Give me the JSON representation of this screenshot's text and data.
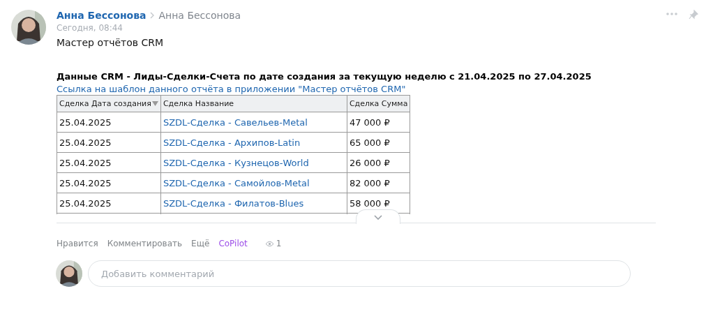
{
  "post": {
    "author": "Анна Бессонова",
    "recipient": "Анна Бессонова",
    "time": "Сегодня, 08:44",
    "title": "Мастер отчётов CRM",
    "report_title": "Данные CRM - Лиды-Сделки-Счета по дате создания за текущую неделю с 21.04.2025 по  27.04.2025",
    "template_link": "Ссылка на шаблон данного отчёта в приложении \"Мастер отчётов CRM\"",
    "table": {
      "columns": [
        {
          "label": "Сделка Дата создания",
          "sorted": true
        },
        {
          "label": "Сделка Название",
          "sorted": false
        },
        {
          "label": "Сделка Сумма",
          "sorted": false
        }
      ],
      "rows": [
        [
          "25.04.2025",
          "SZDL-Сделка - Савельев-Metal",
          "47 000 ₽"
        ],
        [
          "25.04.2025",
          "SZDL-Сделка - Архипов-Latin",
          "65 000 ₽"
        ],
        [
          "25.04.2025",
          "SZDL-Сделка - Кузнецов-World",
          "26 000 ₽"
        ],
        [
          "25.04.2025",
          "SZDL-Сделка - Самойлов-Metal",
          "82 000 ₽"
        ],
        [
          "25.04.2025",
          "SZDL-Сделка - Филатов-Blues",
          "58 000 ₽"
        ]
      ]
    },
    "actions": [
      {
        "label": "Нравится",
        "kind": "plain"
      },
      {
        "label": "Комментировать",
        "kind": "plain"
      },
      {
        "label": "Ещё",
        "kind": "plain"
      },
      {
        "label": "CoPilot",
        "kind": "accent"
      }
    ],
    "views": "1"
  },
  "comment": {
    "placeholder": "Добавить комментарий"
  }
}
